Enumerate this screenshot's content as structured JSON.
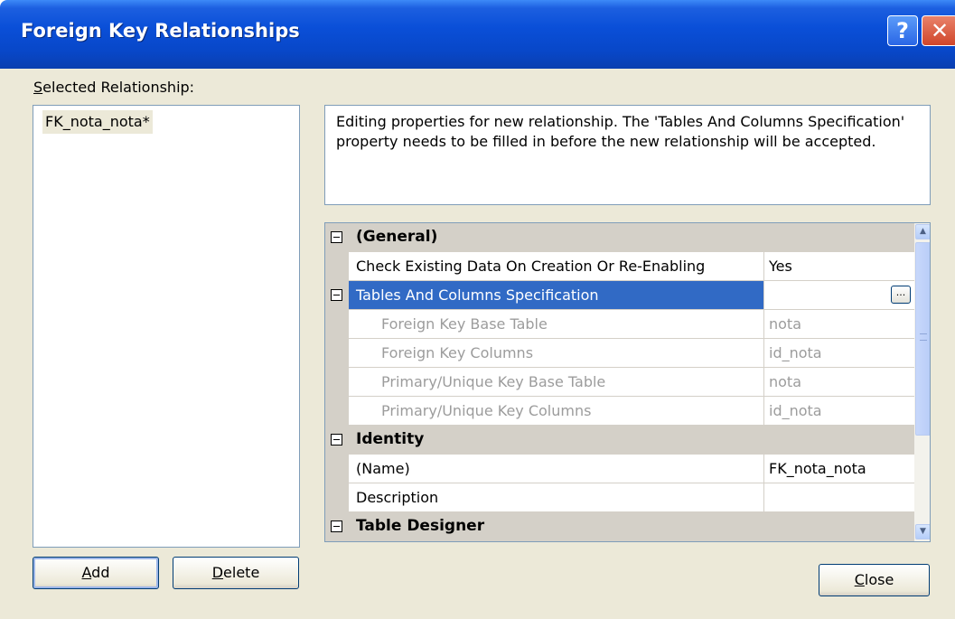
{
  "window": {
    "title": "Foreign Key Relationships",
    "help_glyph": "?",
    "close_glyph": "✕"
  },
  "selected_relationship": {
    "label_accel": "S",
    "label_rest": "elected Relationship:",
    "items": [
      "FK_nota_nota*"
    ]
  },
  "info_text": "Editing properties for new relationship.  The 'Tables And Columns Specification' property needs to be filled in before the new relationship will be accepted.",
  "properties": {
    "general": {
      "category": "(General)",
      "check_existing": {
        "name": "Check Existing Data On Creation Or Re-Enabling",
        "value": "Yes"
      },
      "tables_columns": {
        "name": "Tables And Columns Specification",
        "value": "",
        "button": "..."
      },
      "fk_base_table": {
        "name": "Foreign Key Base Table",
        "value": "nota"
      },
      "fk_columns": {
        "name": "Foreign Key Columns",
        "value": "id_nota"
      },
      "pk_base_table": {
        "name": "Primary/Unique Key Base Table",
        "value": "nota"
      },
      "pk_columns": {
        "name": "Primary/Unique Key Columns",
        "value": "id_nota"
      }
    },
    "identity": {
      "category": "Identity",
      "name": {
        "name": "(Name)",
        "value": "FK_nota_nota"
      },
      "description": {
        "name": "Description",
        "value": ""
      }
    },
    "table_designer": {
      "category": "Table Designer"
    }
  },
  "buttons": {
    "add": {
      "accel": "A",
      "rest": "dd"
    },
    "delete": {
      "accel": "D",
      "rest": "elete"
    },
    "close": {
      "accel": "C",
      "rest": "lose"
    }
  },
  "colors": {
    "title_bar": "#0a4fd8",
    "dialog_bg": "#ece9d8",
    "selection": "#316ac5",
    "category_bg": "#d4d0c8"
  }
}
